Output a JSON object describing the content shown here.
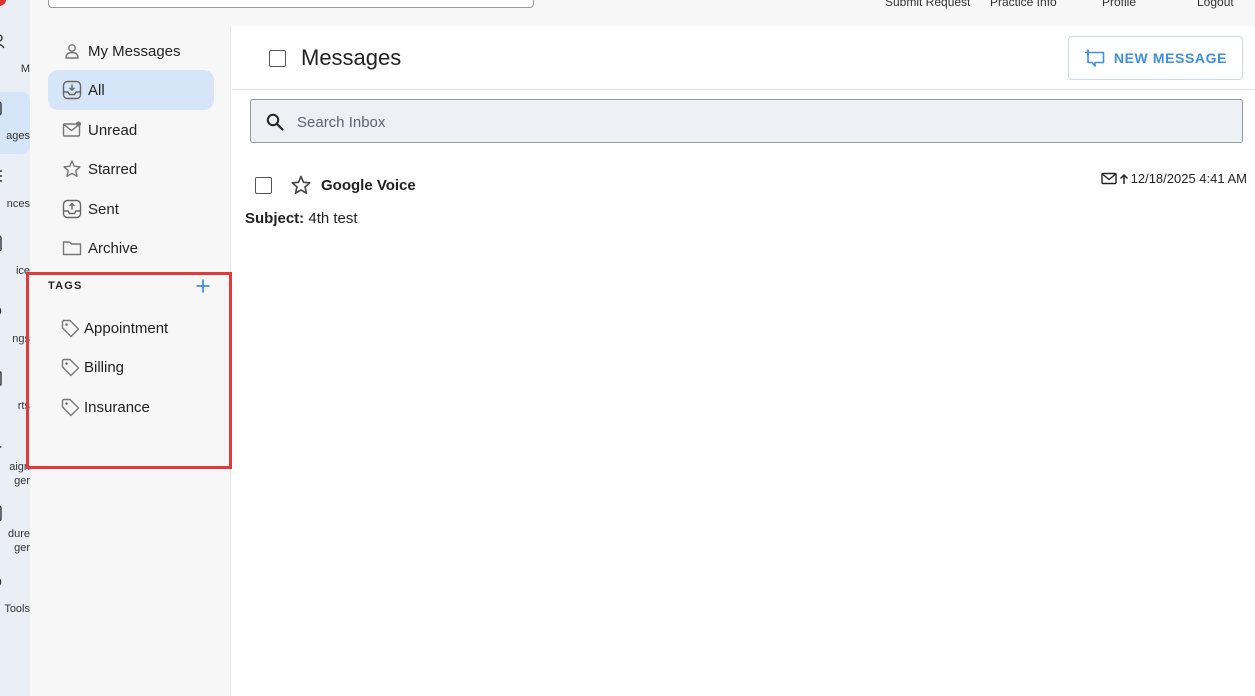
{
  "top_nav": {
    "links": [
      "Submit Request",
      "Practice Info",
      "Profile",
      "Logout"
    ]
  },
  "rail": {
    "items": [
      {
        "label": "M",
        "icon": "people-icon"
      },
      {
        "label": "ages",
        "icon": "messages-icon"
      },
      {
        "label": "nces",
        "icon": "list-icon"
      },
      {
        "label": "ice",
        "icon": "phone-icon"
      },
      {
        "label": "ngs",
        "icon": "gear-icon"
      },
      {
        "label": "rts",
        "icon": "reports-icon"
      },
      {
        "label": "aign\nger",
        "icon": "campaign-icon"
      },
      {
        "label": "dure\nger",
        "icon": "procedure-icon"
      },
      {
        "label": "Tools",
        "icon": "tools-icon"
      }
    ]
  },
  "sidebar": {
    "folders": [
      {
        "label": "My Messages",
        "icon": "person-icon"
      },
      {
        "label": "All",
        "icon": "inbox-icon",
        "active": true
      },
      {
        "label": "Unread",
        "icon": "unread-mail-icon"
      },
      {
        "label": "Starred",
        "icon": "star-icon"
      },
      {
        "label": "Sent",
        "icon": "outbox-icon"
      },
      {
        "label": "Archive",
        "icon": "folder-icon"
      }
    ],
    "tags_heading": "TAGS",
    "tags": [
      {
        "label": "Appointment",
        "icon": "tag-icon"
      },
      {
        "label": "Billing",
        "icon": "tag-icon"
      },
      {
        "label": "Insurance",
        "icon": "tag-icon"
      }
    ]
  },
  "header": {
    "title": "Messages",
    "new_message_label": "NEW MESSAGE"
  },
  "search": {
    "placeholder": "Search Inbox",
    "value": ""
  },
  "messages": [
    {
      "sender": "Google Voice",
      "timestamp": "12/18/2025 4:41 AM",
      "subject_label": "Subject:",
      "subject": "4th test"
    }
  ],
  "colors": {
    "accent": "#3d8fe0",
    "active_bg": "#d6e6f8",
    "highlight": "#e03a3a"
  }
}
